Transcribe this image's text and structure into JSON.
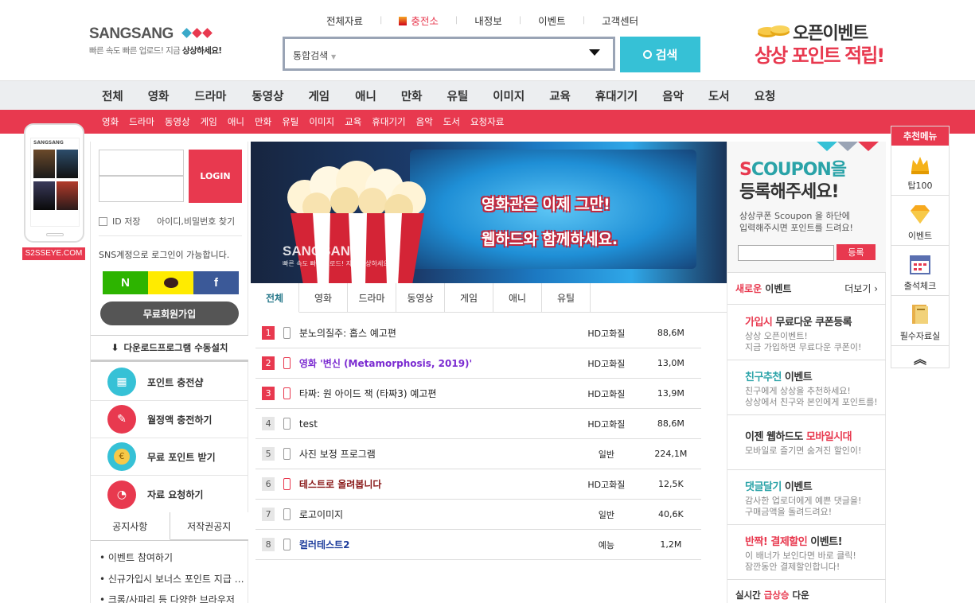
{
  "logo": {
    "brand": "SANGSANG",
    "tagline_prefix": "빠른 속도 빠른 업로드! 지금 ",
    "tagline_strong": "상상하세요!"
  },
  "util_nav": [
    {
      "label": "전체자료"
    },
    {
      "label": "충전소"
    },
    {
      "label": "내정보"
    },
    {
      "label": "이벤트"
    },
    {
      "label": "고객센터"
    }
  ],
  "search": {
    "select_label": "통합검색",
    "button_label": "검색"
  },
  "top_banner": {
    "line1": "오픈이벤트",
    "line2": "상상 포인트 적립!"
  },
  "gnb": [
    "전체",
    "영화",
    "드라마",
    "동영상",
    "게임",
    "애니",
    "만화",
    "유틸",
    "이미지",
    "교육",
    "휴대기기",
    "음악",
    "도서",
    "요청"
  ],
  "subnav": [
    "영화",
    "드라마",
    "동영상",
    "게임",
    "애니",
    "만화",
    "유틸",
    "이미지",
    "교육",
    "휴대기기",
    "음악",
    "도서",
    "요청자료"
  ],
  "domain_label": "S2SSEYE.COM",
  "phone": {
    "logo": "SANGSANG"
  },
  "login": {
    "button_label": "LOGIN",
    "save_id": "ID 저장",
    "find_id": "아이디,비밀번호 찾기",
    "sns_text": "SNS계정으로 로그인이 가능합니다.",
    "sns_naver": "N",
    "sns_facebook": "f",
    "join_label": "무료회원가입",
    "download_label": "다운로드프로그램 수동설치"
  },
  "left_menu": [
    {
      "label": "포인트 충전샵"
    },
    {
      "label": "월정액 충전하기"
    },
    {
      "label": "무료 포인트 받기"
    },
    {
      "label": "자료 요청하기"
    }
  ],
  "notice_tabs": [
    "공지사항",
    "저작권공지"
  ],
  "notices": [
    "• 이벤트 참여하기",
    "• 신규가입시 보너스 포인트 지급 이벤트",
    "• 크롬/사파리 등 다양한 브라우저"
  ],
  "main_banner": {
    "line1": "영화관은 이제 그만!",
    "line2": "웹하드와 함께하세요.",
    "logo": "SANGSANG",
    "logo_sub": "빠른 속도 빠른 업로드! 지금 상상하세요!"
  },
  "content_tabs": [
    "전체",
    "영화",
    "드라마",
    "동영상",
    "게임",
    "애니",
    "유틸"
  ],
  "rows": [
    {
      "rank": "1",
      "title": "분노의질주: 홉스 예고편",
      "quality": "HD고화질",
      "size": "88,6M",
      "hot": true,
      "mobile_red": false,
      "color": "#222222",
      "bold": false
    },
    {
      "rank": "2",
      "title": "영화 '변신 (Metamorphosis, 2019)'",
      "quality": "HD고화질",
      "size": "13,0M",
      "hot": true,
      "mobile_red": true,
      "color": "#7b2bd1",
      "bold": true
    },
    {
      "rank": "3",
      "title": "타짜: 원 아이드 잭 (타짜3) 예고편",
      "quality": "HD고화질",
      "size": "13,9M",
      "hot": true,
      "mobile_red": true,
      "color": "#222222",
      "bold": false
    },
    {
      "rank": "4",
      "title": "test",
      "quality": "HD고화질",
      "size": "88,6M",
      "hot": false,
      "mobile_red": false,
      "color": "#222222",
      "bold": false
    },
    {
      "rank": "5",
      "title": "사진 보정 프로그램",
      "quality": "일반",
      "size": "224,1M",
      "hot": false,
      "mobile_red": false,
      "color": "#222222",
      "bold": false
    },
    {
      "rank": "6",
      "title": "테스트로 올려봅니다",
      "quality": "HD고화질",
      "size": "12,5K",
      "hot": false,
      "mobile_red": true,
      "color": "#8a1a1a",
      "bold": true
    },
    {
      "rank": "7",
      "title": "로고이미지",
      "quality": "일반",
      "size": "40,6K",
      "hot": false,
      "mobile_red": false,
      "color": "#222222",
      "bold": false
    },
    {
      "rank": "8",
      "title": "컬러테스트2",
      "quality": "예능",
      "size": "1,2M",
      "hot": false,
      "mobile_red": false,
      "color": "#1e3d9c",
      "bold": true
    }
  ],
  "coupon": {
    "title_s": "S",
    "title_rest": "COUPON을",
    "title_line2": "등록해주세요!",
    "desc1": "상상쿠폰 Scoupon 을 하단에",
    "desc2": "입력해주시면 포인트를 드려요!",
    "button_label": "등록"
  },
  "events_head": {
    "new": "새로운",
    "label": " 이벤트",
    "more": "더보기 ›"
  },
  "events": [
    {
      "hl": "가입시",
      "rest": " 무료다운 쿠폰등록",
      "hl_color": "#e8394f",
      "d1": "상상 오픈이벤트!",
      "d2": "지금 가입하면 무료다운 쿠폰이!"
    },
    {
      "hl": "친구추천",
      "rest": " 이벤트",
      "hl_color": "#2aa3a8",
      "d1": "친구에게 상상을 추천하세요!",
      "d2": "상상에서 친구와 본인에게 포인트를!"
    },
    {
      "hl": "이젠 웹하드도 ",
      "rest": "모바일시대",
      "hl_color": "#333333",
      "rest_color": "#e8394f",
      "d1": "모바일로 즐기면 숨겨진 할인이!",
      "d2": ""
    },
    {
      "hl": "댓글달기",
      "rest": " 이벤트",
      "hl_color": "#2aa3a8",
      "d1": "감사한 업로더에게 예쁜 댓글을!",
      "d2": "구매금액을 돌려드려요!"
    },
    {
      "hl": "반짝! 결제할인",
      "rest": " 이벤트!",
      "hl_color": "#e8394f",
      "d1": "이 배너가 보인다면 바로 클릭!",
      "d2": "잠깐동안 결제할인합니다!"
    }
  ],
  "realtime": {
    "prefix": "실시간 ",
    "hl": "급상승",
    "suffix": " 다운"
  },
  "recommend": {
    "head": "추천메뉴",
    "items": [
      "탑100",
      "이벤트",
      "출석체크",
      "필수자료실"
    ],
    "up": "︽"
  },
  "colors": {
    "accent": "#e8394f",
    "search": "#36c1d6",
    "teal": "#2a7a8c"
  }
}
